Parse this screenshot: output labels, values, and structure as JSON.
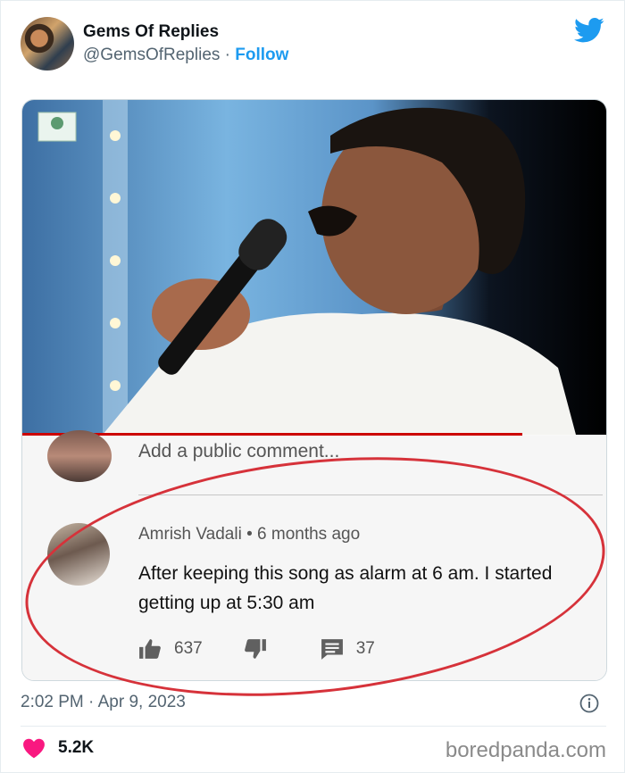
{
  "tweet": {
    "author_name": "Gems Of Replies",
    "author_handle": "@GemsOfReplies",
    "separator": " · ",
    "follow_label": "Follow",
    "timestamp": "2:02 PM · Apr 9, 2023",
    "likes": "5.2K"
  },
  "youtube": {
    "add_comment_placeholder": "Add a public comment...",
    "commenter": "Amrish Vadali",
    "comment_age": "6 months ago",
    "comment_text": "After keeping this song as alarm at 6 am. I started getting up at 5:30 am",
    "like_count": "637",
    "reply_count": "37"
  },
  "watermark": "boredpanda.com",
  "colors": {
    "twitter_blue": "#1d9bf0",
    "like_pink": "#f91880",
    "annotation_red": "#d6323a",
    "youtube_red": "#cc0000"
  },
  "icons": [
    "twitter-bird-icon",
    "thumbs-up-icon",
    "thumbs-down-icon",
    "reply-icon",
    "info-icon",
    "heart-icon"
  ]
}
